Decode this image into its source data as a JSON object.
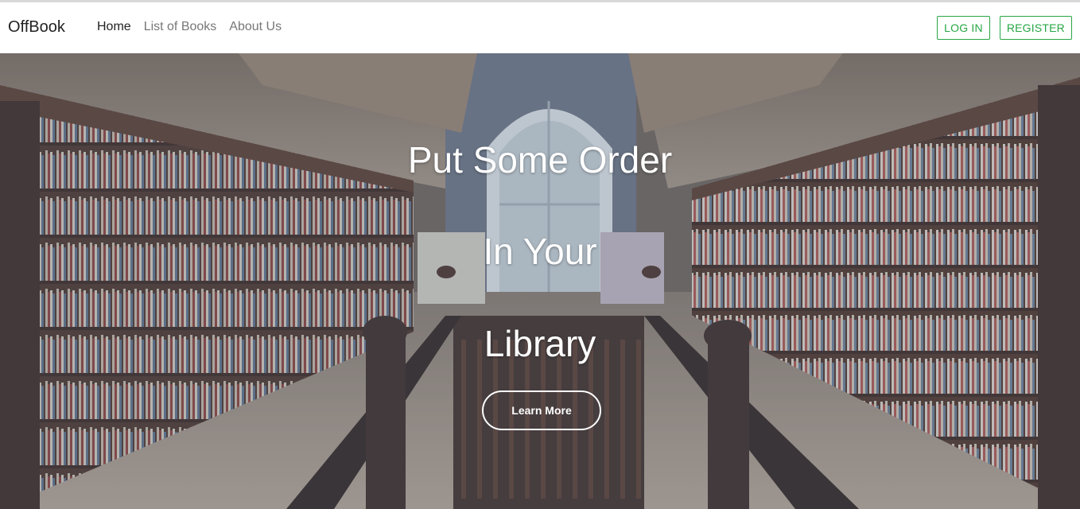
{
  "navbar": {
    "brand": "OffBook",
    "links": [
      {
        "label": "Home"
      },
      {
        "label": "List of Books"
      },
      {
        "label": "About Us"
      }
    ],
    "login_label": "LOG IN",
    "register_label": "REGISTER",
    "accent_color": "#28a745"
  },
  "hero": {
    "headline_lines": [
      "Put Some Order",
      "In Your",
      "Library"
    ],
    "cta_label": "Learn More"
  }
}
